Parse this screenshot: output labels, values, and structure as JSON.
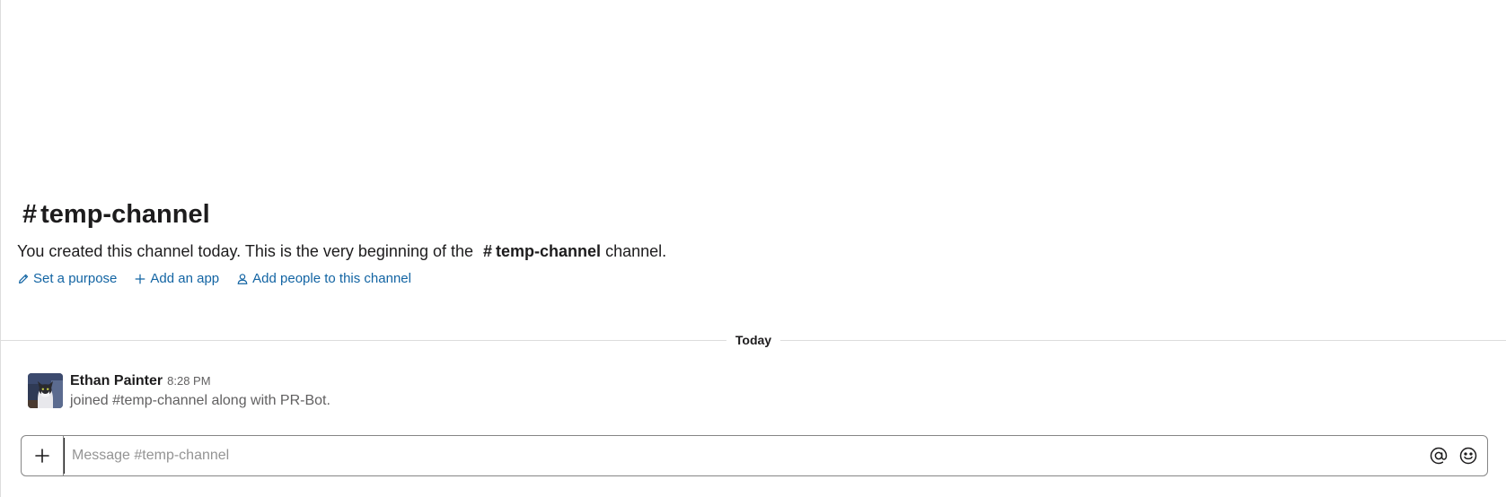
{
  "channel": {
    "hash": "#",
    "name": "temp-channel"
  },
  "intro": {
    "text_before": "You created this channel today. This is the very beginning of the",
    "ref_hash": "#",
    "ref_name": "temp-channel",
    "text_after": " channel."
  },
  "actions": [
    {
      "label": "Set a purpose",
      "icon": "pencil-icon"
    },
    {
      "label": "Add an app",
      "icon": "plus-icon"
    },
    {
      "label": "Add people to this channel",
      "icon": "person-icon"
    }
  ],
  "divider": {
    "label": "Today"
  },
  "message": {
    "sender": "Ethan Painter",
    "time": "8:28 PM",
    "text": "joined #temp-channel along with PR-Bot."
  },
  "composer": {
    "placeholder": "Message #temp-channel",
    "attach_icon": "plus-icon",
    "mention_icon": "at-icon",
    "emoji_icon": "emoji-icon"
  },
  "colors": {
    "link": "#1264a3",
    "text": "#1d1c1d",
    "muted": "#616061",
    "border": "#868686"
  }
}
